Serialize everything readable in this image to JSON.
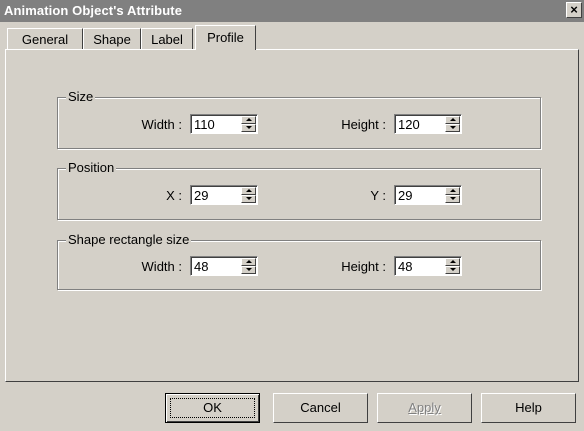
{
  "window": {
    "title": "Animation Object's Attribute",
    "close_glyph": "×"
  },
  "tabs": [
    {
      "label": "General"
    },
    {
      "label": "Shape"
    },
    {
      "label": "Label"
    },
    {
      "label": "Profile",
      "active": true
    }
  ],
  "groups": {
    "size": {
      "legend": "Size",
      "left_label": "Width :",
      "left_value": "110",
      "right_label": "Height :",
      "right_value": "120"
    },
    "position": {
      "legend": "Position",
      "left_label": "X :",
      "left_value": "29",
      "right_label": "Y :",
      "right_value": "29"
    },
    "shape_rect": {
      "legend": "Shape rectangle size",
      "left_label": "Width :",
      "left_value": "48",
      "right_label": "Height :",
      "right_value": "48"
    }
  },
  "buttons": {
    "ok": "OK",
    "cancel": "Cancel",
    "apply": "Apply",
    "help": "Help"
  }
}
